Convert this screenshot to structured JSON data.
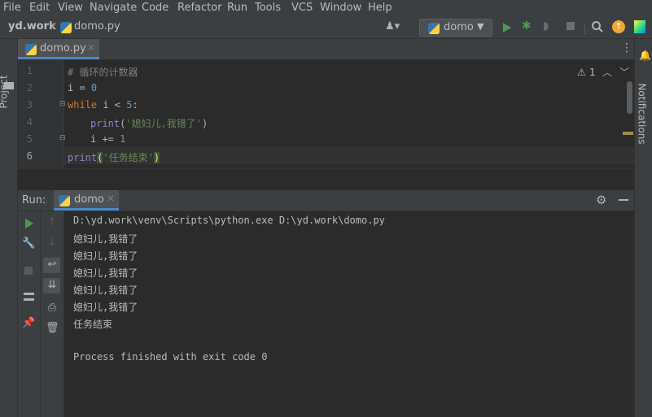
{
  "menu": [
    "File",
    "Edit",
    "View",
    "Navigate",
    "Code",
    "Refactor",
    "Run",
    "Tools",
    "VCS",
    "Window",
    "Help"
  ],
  "breadcrumb": {
    "project": "yd.work",
    "file": "domo.py"
  },
  "run_config": "domo",
  "side_left": {
    "project": "Project"
  },
  "side_right": {
    "notifications": "Notifications"
  },
  "editor": {
    "tab": "domo.py",
    "warnings": "1",
    "line_numbers": [
      "1",
      "2",
      "3",
      "4",
      "5",
      "6"
    ]
  },
  "code": {
    "l1": "# 循环的计数器",
    "l2_var": "i = ",
    "l2_num": "0",
    "l3_kw": "while",
    "l3_mid": " i < ",
    "l3_num": "5",
    "l3_end": ":",
    "l4_fn": "print",
    "l4_open": "(",
    "l4_str": "'媳妇儿,我错了'",
    "l4_close": ")",
    "l5_var": "i += ",
    "l5_num": "1",
    "l6_fn": "print",
    "l6_open": "(",
    "l6_str": "'任务结束'",
    "l6_close": ")"
  },
  "run": {
    "label": "Run:",
    "tab": "domo",
    "output": [
      "D:\\yd.work\\venv\\Scripts\\python.exe D:\\yd.work\\domo.py",
      "媳妇儿,我错了",
      "媳妇儿,我错了",
      "媳妇儿,我错了",
      "媳妇儿,我错了",
      "媳妇儿,我错了",
      "任务结束",
      "",
      "Process finished with exit code 0"
    ]
  },
  "colors": {
    "accent_green": "#499c54",
    "bg": "#2b2b2b",
    "panel": "#3c3f41"
  }
}
